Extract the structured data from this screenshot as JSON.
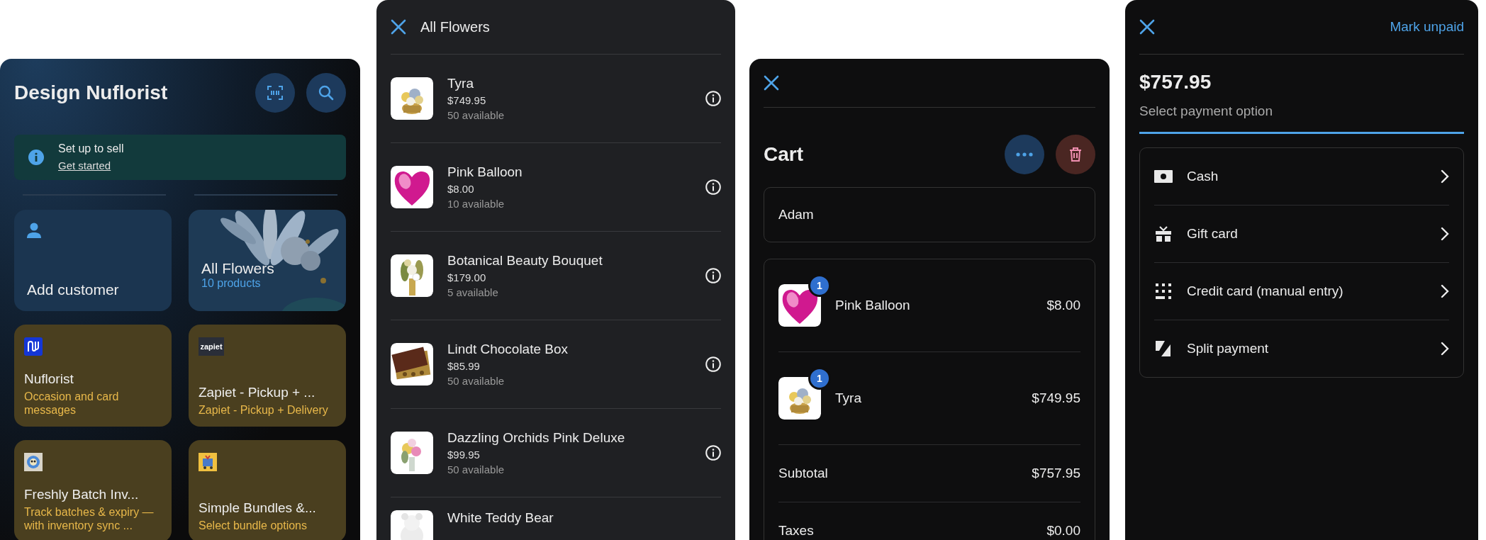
{
  "home": {
    "title": "Design Nuflorist",
    "banner": {
      "title": "Set up to sell",
      "link": "Get started"
    },
    "tiles": [
      {
        "kind": "action",
        "label": "Add customer"
      },
      {
        "kind": "collection",
        "label": "All Flowers",
        "subtitle": "10 products"
      }
    ],
    "apps": [
      {
        "kind": "nu",
        "name": "Nuflorist",
        "description": "Occasion and card messages"
      },
      {
        "kind": "zapiet",
        "logo_text": "zapiet",
        "name": "Zapiet - Pickup + ...",
        "description": "Zapiet - Pickup + Delivery"
      },
      {
        "kind": "batch",
        "name": "Freshly Batch Inv...",
        "description": "Track batches & expiry —with inventory sync ..."
      },
      {
        "kind": "bundle",
        "name": "Simple Bundles &...",
        "description": "Select bundle options"
      }
    ]
  },
  "collection": {
    "title": "All Flowers",
    "products": [
      {
        "name": "Tyra",
        "price": "$749.95",
        "stock": "50 available"
      },
      {
        "name": "Pink Balloon",
        "price": "$8.00",
        "stock": "10 available"
      },
      {
        "name": "Botanical Beauty Bouquet",
        "price": "$179.00",
        "stock": "5 available"
      },
      {
        "name": "Lindt Chocolate Box",
        "price": "$85.99",
        "stock": "50 available"
      },
      {
        "name": "Dazzling Orchids Pink Deluxe",
        "price": "$99.95",
        "stock": "50 available"
      },
      {
        "name": "White Teddy Bear"
      }
    ]
  },
  "cart": {
    "title": "Cart",
    "customer": "Adam",
    "items": [
      {
        "name": "Pink Balloon",
        "quantity": "1",
        "price": "$8.00"
      },
      {
        "name": "Tyra",
        "quantity": "1",
        "price": "$749.95"
      }
    ],
    "totals": [
      {
        "label": "Subtotal",
        "value": "$757.95"
      },
      {
        "label": "Taxes",
        "value": "$0.00"
      }
    ]
  },
  "payment": {
    "action": "Mark unpaid",
    "amount": "$757.95",
    "subtitle": "Select payment option",
    "options": [
      {
        "kind": "cash",
        "label": "Cash"
      },
      {
        "kind": "gift",
        "label": "Gift card"
      },
      {
        "kind": "manual",
        "label": "Credit card (manual entry)"
      },
      {
        "kind": "split",
        "label": "Split payment"
      }
    ]
  }
}
